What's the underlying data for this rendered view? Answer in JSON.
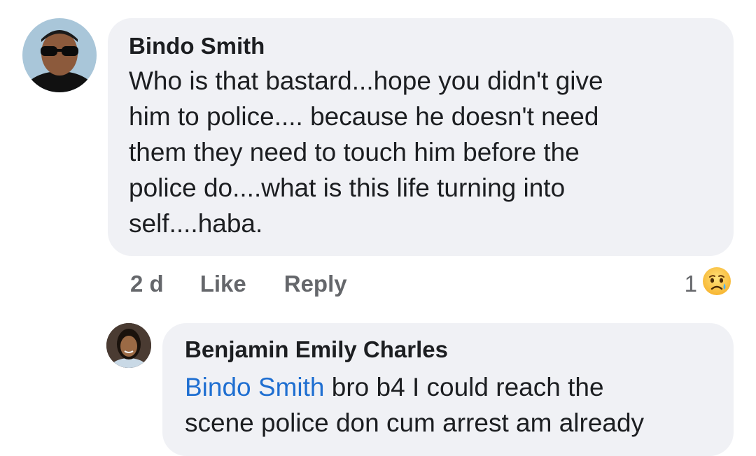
{
  "comment": {
    "author": "Bindo Smith",
    "text_lines": [
      "Who is that bastard...hope you didn't give",
      "him to police.... because he doesn't need",
      "them they need to touch him before the",
      "police do....what is this life turning into",
      "self....haba."
    ],
    "time": "2 d",
    "like_label": "Like",
    "reply_label": "Reply",
    "reaction_count": "1",
    "reaction_icon": "sad-reaction-icon"
  },
  "reply": {
    "author": "Benjamin Emily Charles",
    "mention": "Bindo Smith",
    "text_first": " bro b4 I could reach the",
    "text_second": "scene police don cum arrest am already"
  },
  "colors": {
    "bubble": "#f0f1f5",
    "mention": "#1f6fd1",
    "meta_text": "#65676b"
  }
}
